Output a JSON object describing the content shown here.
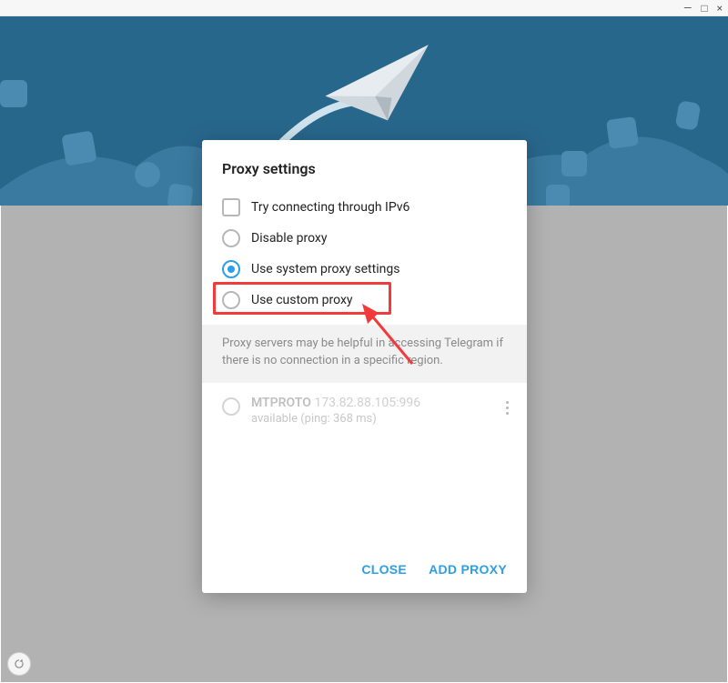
{
  "window": {
    "minimize": "—",
    "maximize": "□",
    "close": "×"
  },
  "dialog": {
    "title": "Proxy settings",
    "options": {
      "ipv6": "Try connecting through IPv6",
      "disable": "Disable proxy",
      "system": "Use system proxy settings",
      "custom": "Use custom proxy"
    },
    "selected_option": "system",
    "info": "Proxy servers may be helpful in accessing Telegram if there is no connection in a specific region.",
    "proxy": {
      "protocol": "MTPROTO",
      "address": "173.82.88.105:996",
      "status": "available (ping: 368 ms)"
    },
    "actions": {
      "close": "CLOSE",
      "add": "ADD PROXY"
    }
  }
}
